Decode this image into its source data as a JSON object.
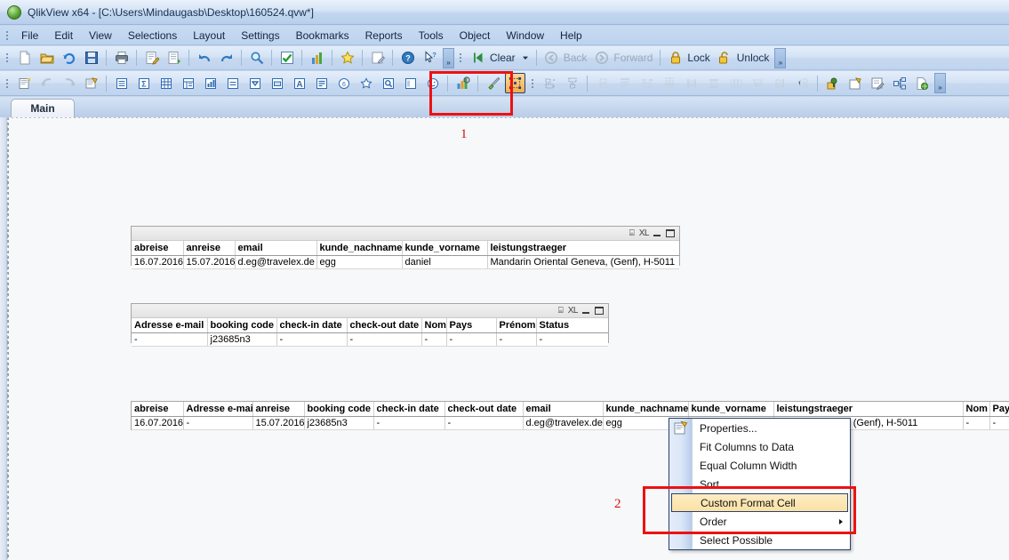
{
  "window": {
    "title": "QlikView x64 - [C:\\Users\\Mindaugasb\\Desktop\\160524.qvw*]",
    "app_icon": "qlikview-logo-icon"
  },
  "menubar": {
    "items": [
      {
        "label": "File"
      },
      {
        "label": "Edit"
      },
      {
        "label": "View"
      },
      {
        "label": "Selections"
      },
      {
        "label": "Layout"
      },
      {
        "label": "Settings"
      },
      {
        "label": "Bookmarks"
      },
      {
        "label": "Reports"
      },
      {
        "label": "Tools"
      },
      {
        "label": "Object"
      },
      {
        "label": "Window"
      },
      {
        "label": "Help"
      }
    ]
  },
  "toolbar_standard": {
    "buttons": [
      {
        "name": "new-document-icon"
      },
      {
        "name": "open-document-icon"
      },
      {
        "name": "reload-icon"
      },
      {
        "name": "save-icon"
      },
      {
        "name": "print-icon"
      },
      {
        "name": "edit-script-icon"
      },
      {
        "name": "table-viewer-icon"
      },
      {
        "name": "undo-icon"
      },
      {
        "name": "redo-icon"
      },
      {
        "name": "search-icon"
      },
      {
        "name": "current-selections-icon"
      },
      {
        "name": "quick-chart-wizard-icon"
      },
      {
        "name": "favorites-icon"
      },
      {
        "name": "edit-module-icon"
      },
      {
        "name": "help-icon"
      },
      {
        "name": "context-help-icon"
      }
    ],
    "clear_label": "Clear",
    "clear_icon": "clear-selections-icon",
    "back_label": "Back",
    "back_icon": "back-arrow-icon",
    "forward_label": "Forward",
    "forward_icon": "forward-arrow-icon",
    "lock_label": "Lock",
    "lock_icon": "lock-closed-icon",
    "unlock_label": "Unlock",
    "unlock_icon": "lock-open-icon",
    "overflow_glyph": "»"
  },
  "toolbar_design": {
    "buttons": [
      {
        "name": "new-sheet-icon"
      },
      {
        "name": "previous-sheet-icon"
      },
      {
        "name": "next-sheet-icon"
      },
      {
        "name": "sheet-properties-icon"
      },
      {
        "name": "list-box-icon"
      },
      {
        "name": "statistics-box-icon"
      },
      {
        "name": "table-box-icon"
      },
      {
        "name": "pivot-table-icon"
      },
      {
        "name": "chart-icon"
      },
      {
        "name": "input-box-icon"
      },
      {
        "name": "multi-box-icon"
      },
      {
        "name": "current-selections-box-icon"
      },
      {
        "name": "text-object-icon"
      },
      {
        "name": "button-object-icon"
      },
      {
        "name": "slider-calendar-icon"
      },
      {
        "name": "bookmark-object-icon"
      },
      {
        "name": "search-object-icon"
      },
      {
        "name": "container-object-icon"
      },
      {
        "name": "custom-object-icon"
      },
      {
        "name": "design-grid-toggle-icon"
      }
    ],
    "format_painter_icon": "format-painter-icon",
    "design_grid_icon": "design-grid-icon",
    "align_buttons": [
      {
        "name": "align-left-icon"
      },
      {
        "name": "align-center-icon"
      },
      {
        "name": "align-right-icon"
      },
      {
        "name": "align-top-icon"
      },
      {
        "name": "align-middle-icon"
      },
      {
        "name": "align-bottom-icon"
      },
      {
        "name": "distribute-horizontal-icon"
      },
      {
        "name": "distribute-vertical-icon"
      },
      {
        "name": "space-horizontal-icon"
      },
      {
        "name": "space-vertical-icon"
      },
      {
        "name": "resize-equal-icon"
      },
      {
        "name": "adjust-position-icon"
      }
    ],
    "right_buttons": [
      {
        "name": "bring-to-front-icon"
      },
      {
        "name": "send-to-back-icon"
      },
      {
        "name": "edit-expression-icon"
      },
      {
        "name": "linked-objects-icon"
      },
      {
        "name": "export-web-icon"
      }
    ],
    "overflow_glyph": "»"
  },
  "sheet": {
    "tab_label": "Main"
  },
  "table1": {
    "name": "table-box-1",
    "caption_icons": [
      {
        "name": "print-object-icon",
        "glyph": "⌸"
      },
      {
        "name": "export-to-excel-icon",
        "glyph": "XL"
      },
      {
        "name": "minimize-object-icon"
      },
      {
        "name": "maximize-object-icon"
      }
    ],
    "columns": [
      "abreise",
      "anreise",
      "email",
      "kunde_nachname",
      "kunde_vorname",
      "leistungstraeger"
    ],
    "rows": [
      [
        "16.07.2016",
        "15.07.2016",
        "d.eg@travelex.de",
        "egg",
        "daniel",
        "Mandarin Oriental Geneva, (Genf), H-5011"
      ]
    ]
  },
  "table2": {
    "name": "table-box-2",
    "caption_icons": [
      {
        "name": "print-object-icon",
        "glyph": "⌸"
      },
      {
        "name": "export-to-excel-icon",
        "glyph": "XL"
      },
      {
        "name": "minimize-object-icon"
      },
      {
        "name": "maximize-object-icon"
      }
    ],
    "columns": [
      "Adresse e-mail",
      "booking code",
      "check-in date",
      "check-out date",
      "Nom",
      "Pays",
      "Prénom",
      "Status"
    ],
    "rows": [
      [
        "-",
        "j23685n3",
        "-",
        "-",
        "-",
        "-",
        "-",
        "-"
      ]
    ]
  },
  "table3": {
    "name": "table-box-3",
    "columns": [
      "abreise",
      "Adresse e-mail",
      "anreise",
      "booking code",
      "check-in date",
      "check-out date",
      "email",
      "kunde_nachname",
      "kunde_vorname",
      "leistungstraeger",
      "Nom",
      "Pay"
    ],
    "rows": [
      [
        "16.07.2016",
        "-",
        "15.07.2016",
        "j23685n3",
        "-",
        "-",
        "d.eg@travelex.de",
        "egg",
        "",
        "Oriental Geneva, (Genf), H-5011",
        "-",
        "-"
      ]
    ]
  },
  "context_menu": {
    "name": "table-object-context-menu",
    "items": [
      {
        "label": "Properties...",
        "icon": "properties-icon",
        "highlighted": false,
        "submenu": false
      },
      {
        "label": "Fit Columns to Data",
        "icon": "",
        "highlighted": false,
        "submenu": false
      },
      {
        "label": "Equal Column Width",
        "icon": "",
        "highlighted": false,
        "submenu": false
      },
      {
        "label": "Sort",
        "icon": "",
        "highlighted": false,
        "submenu": false
      },
      {
        "label": "Custom Format Cell",
        "icon": "",
        "highlighted": true,
        "submenu": false
      },
      {
        "label": "Order",
        "icon": "",
        "highlighted": false,
        "submenu": true
      },
      {
        "label": "Select Possible",
        "icon": "",
        "highlighted": false,
        "submenu": false
      }
    ]
  },
  "annotations": {
    "step1": "1",
    "step2": "2",
    "color": "#ee1111"
  }
}
